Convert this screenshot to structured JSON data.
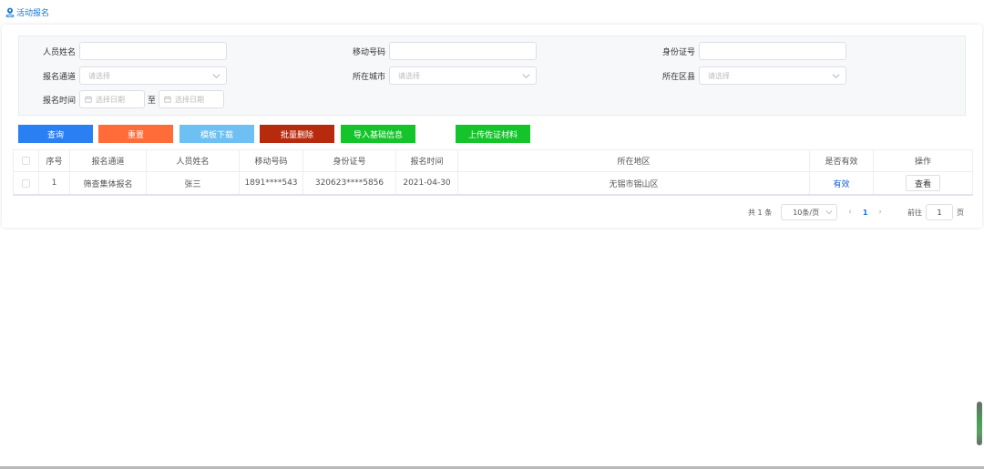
{
  "breadcrumb": {
    "label": "活动报名",
    "icon": "location-person-icon"
  },
  "filters": {
    "name_label": "人员姓名",
    "mobile_label": "移动号码",
    "idcard_label": "身份证号",
    "channel_label": "报名通道",
    "channel_placeholder": "请选择",
    "city_label": "所在城市",
    "city_placeholder": "请选择",
    "district_label": "所在区县",
    "district_placeholder": "请选择",
    "time_label": "报名时间",
    "start_placeholder": "选择日期",
    "end_placeholder": "选择日期",
    "to_label": "至"
  },
  "buttons": {
    "query": "查询",
    "reset": "重置",
    "template_download": "模板下载",
    "batch_delete": "批量删除",
    "import_basic": "导入基础信息",
    "upload_proof": "上传佐证材料"
  },
  "colors": {
    "query": "#2a7ff2",
    "reset": "#ff6c3a",
    "template_download": "#6ec0f2",
    "batch_delete": "#b82a0e",
    "import_basic": "#15c42b",
    "upload_proof": "#15c42b"
  },
  "table": {
    "headers": [
      "序号",
      "报名通道",
      "人员姓名",
      "移动号码",
      "身份证号",
      "报名时间",
      "所在地区",
      "是否有效",
      "操作"
    ],
    "rows": [
      {
        "index": "1",
        "channel": "筛查集体报名",
        "name": "张三",
        "mobile": "1891****543",
        "idcard": "320623****5856",
        "date": "2021-04-30",
        "region": "无锡市锡山区",
        "valid": "有效",
        "action": "查看"
      }
    ]
  },
  "pagination": {
    "total": "共 1 条",
    "page_size": "10条/页",
    "prev": "‹",
    "current": "1",
    "next": "›",
    "goto_label": "前往",
    "goto_value": "1",
    "page_suffix": "页"
  }
}
